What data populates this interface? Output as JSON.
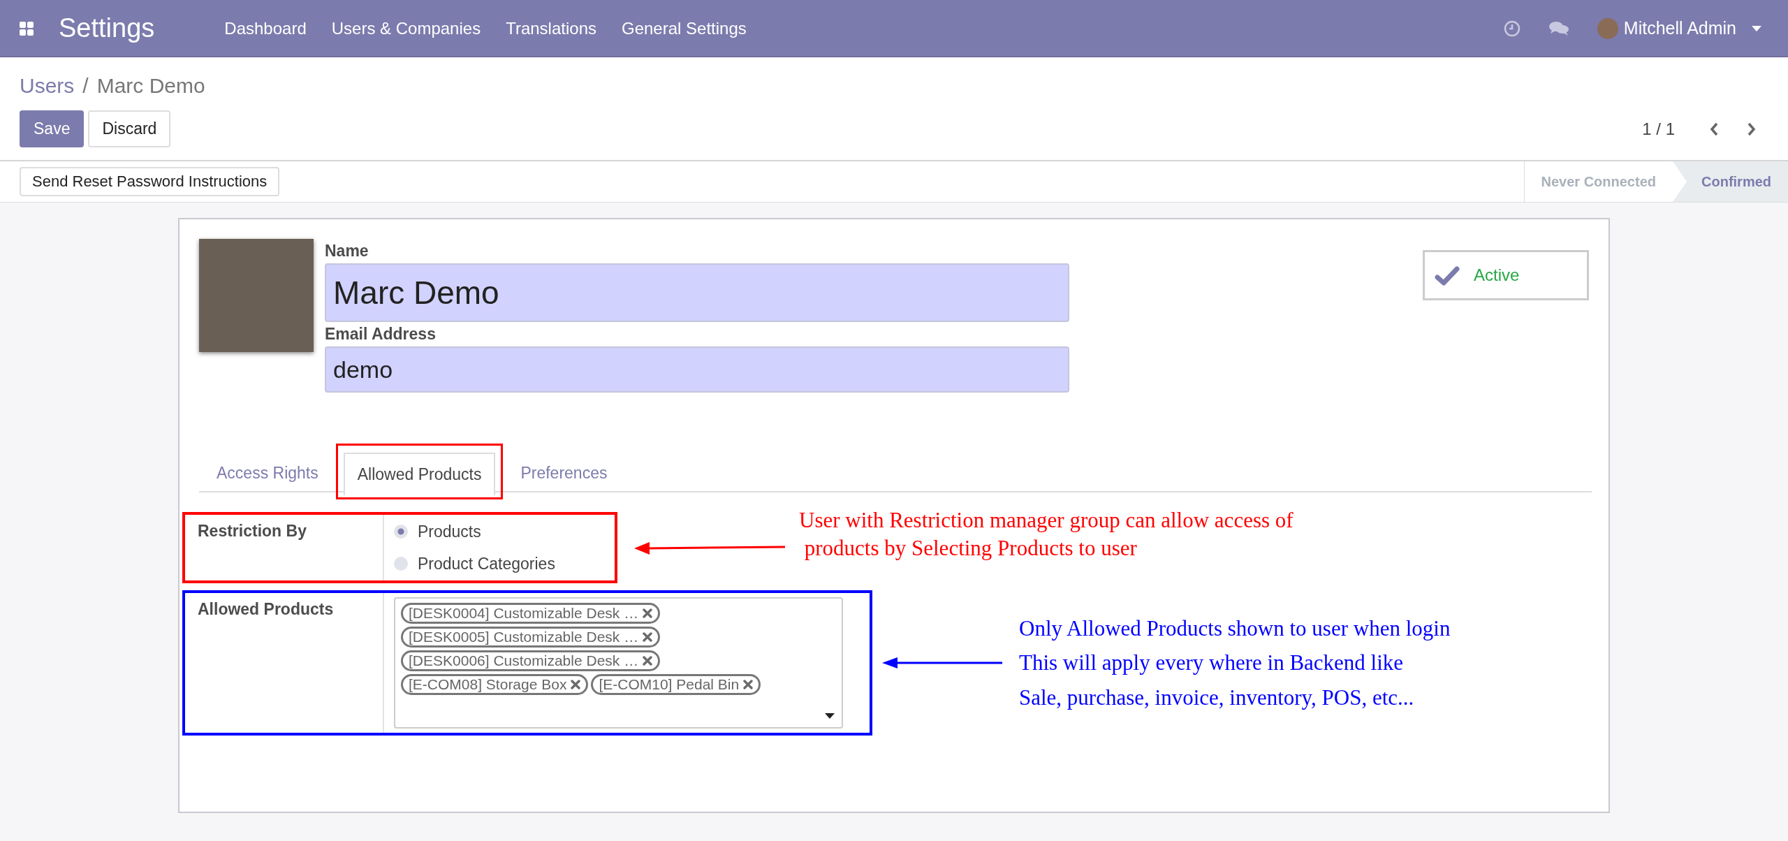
{
  "top_bar": {
    "app_title": "Settings",
    "menu": [
      "Dashboard",
      "Users & Companies",
      "Translations",
      "General Settings"
    ],
    "user": "Mitchell Admin"
  },
  "breadcrumb": {
    "parent": "Users",
    "separator": "/",
    "current": "Marc Demo"
  },
  "buttons": [
    {
      "label": "Save",
      "kind": "primary"
    },
    {
      "label": "Discard",
      "kind": "secondary"
    }
  ],
  "pager": "1 / 1",
  "header_button": "Send Reset Password Instructions",
  "status_bar": [
    {
      "label": "Never Connected",
      "selected": false
    },
    {
      "label": "Confirmed",
      "selected": true
    }
  ],
  "form": {
    "name_label": "Name",
    "name": "Marc Demo",
    "email_label": "Email Address",
    "email": "demo",
    "active": {
      "label": "Active",
      "checked": true
    }
  },
  "tabs": [
    {
      "label": "Access Rights",
      "selected": false,
      "highlighted": false
    },
    {
      "label": "Allowed Products",
      "selected": true,
      "highlighted": true
    },
    {
      "label": "Preferences",
      "selected": false,
      "highlighted": false
    }
  ],
  "restriction": {
    "label": "Restriction By",
    "options": [
      {
        "label": "Products",
        "selected": true
      },
      {
        "label": "Product Categories",
        "selected": false
      }
    ]
  },
  "allowed_products": {
    "label": "Allowed Products",
    "tags": [
      "[DESK0004] Customizable Desk …",
      "[DESK0005] Customizable Desk …",
      "[DESK0006] Customizable Desk …",
      "[E-COM08] Storage Box",
      "[E-COM10] Pedal Bin"
    ]
  },
  "annotations": [
    {
      "text": "User with Restriction manager group can allow access of\n products by Selecting Products to user",
      "color": "#ff0000"
    },
    {
      "text": "Only Allowed Products shown to user when login\nThis will apply every where in Backend like\nSale, purchase, invoice, inventory, POS, etc...",
      "color": "#0000ff"
    }
  ]
}
